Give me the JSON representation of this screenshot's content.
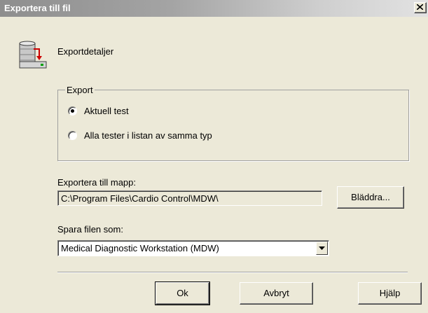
{
  "window": {
    "title": "Exportera till fil",
    "close_glyph": "✕"
  },
  "header": {
    "icon": "export-database-icon",
    "text": "Exportdetaljer"
  },
  "export_group": {
    "legend": "Export",
    "options": [
      {
        "label": "Aktuell test",
        "checked": true
      },
      {
        "label": "Alla tester i listan av samma typ",
        "checked": false
      }
    ]
  },
  "folder": {
    "label": "Exportera till mapp:",
    "value": "C:\\Program Files\\Cardio Control\\MDW\\",
    "browse_label": "Bläddra..."
  },
  "save_as": {
    "label": "Spara filen som:",
    "selected": "Medical Diagnostic Workstation (MDW)"
  },
  "buttons": {
    "ok": "Ok",
    "cancel": "Avbryt",
    "help": "Hjälp"
  }
}
